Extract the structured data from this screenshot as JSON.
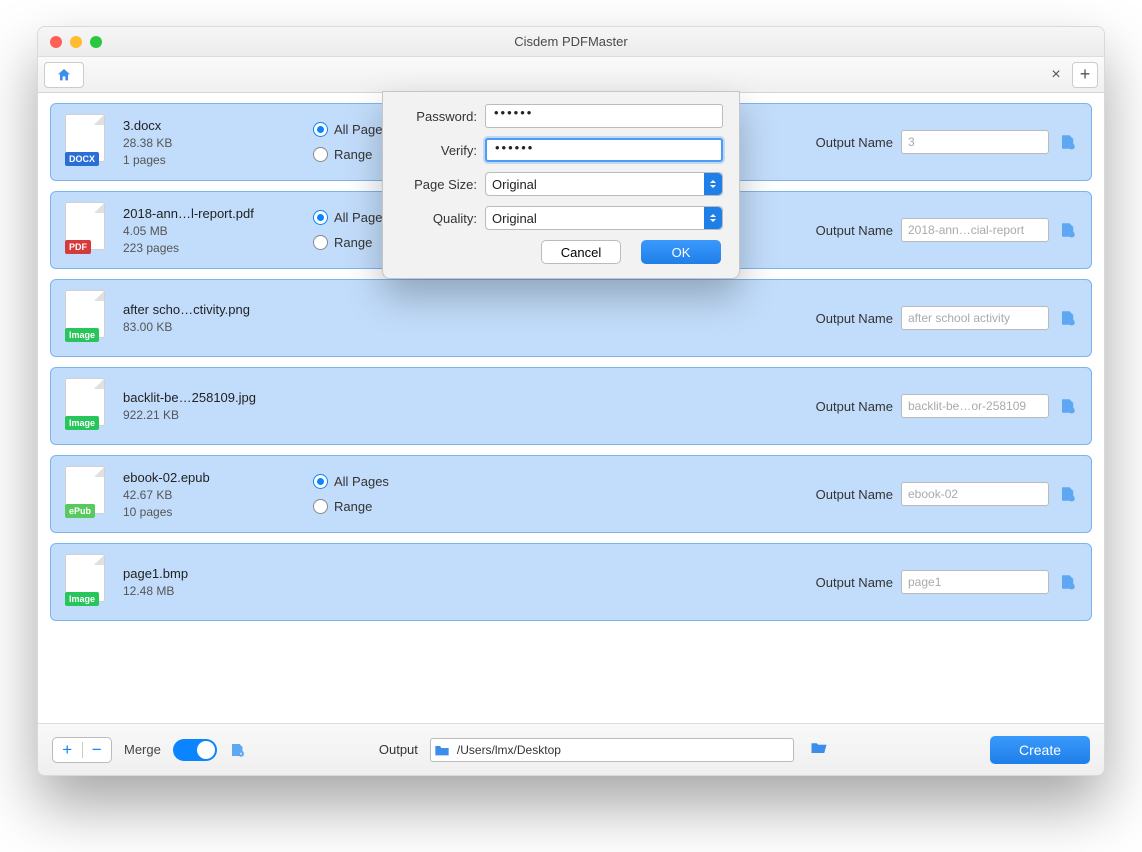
{
  "app": {
    "title": "Cisdem PDFMaster"
  },
  "toolbar": {
    "close": "×",
    "add": "+"
  },
  "files": [
    {
      "icon": "docx",
      "badge": "DOCX",
      "name": "3.docx",
      "size": "28.38 KB",
      "pages": "1 pages",
      "hasPages": true,
      "allPages": "All Pages",
      "range": "Range",
      "outLabel": "Output Name",
      "outValue": "3"
    },
    {
      "icon": "pdf",
      "badge": "PDF",
      "name": "2018-ann…l-report.pdf",
      "size": "4.05 MB",
      "pages": "223 pages",
      "hasPages": true,
      "allPages": "All Pages",
      "range": "Range",
      "outLabel": "Output Name",
      "outValue": "2018-ann…cial-report"
    },
    {
      "icon": "img",
      "badge": "Image",
      "name": "after scho…ctivity.png",
      "size": "83.00 KB",
      "pages": "",
      "hasPages": false,
      "outLabel": "Output Name",
      "outValue": "after school activity"
    },
    {
      "icon": "img",
      "badge": "Image",
      "name": "backlit-be…258109.jpg",
      "size": "922.21 KB",
      "pages": "",
      "hasPages": false,
      "outLabel": "Output Name",
      "outValue": "backlit-be…or-258109"
    },
    {
      "icon": "epub",
      "badge": "ePub",
      "name": "ebook-02.epub",
      "size": "42.67 KB",
      "pages": "10 pages",
      "hasPages": true,
      "allPages": "All Pages",
      "range": "Range",
      "outLabel": "Output Name",
      "outValue": "ebook-02"
    },
    {
      "icon": "img",
      "badge": "Image",
      "name": "page1.bmp",
      "size": "12.48 MB",
      "pages": "",
      "hasPages": false,
      "outLabel": "Output Name",
      "outValue": "page1"
    }
  ],
  "bottom": {
    "merge": "Merge",
    "outputLabel": "Output",
    "outputPath": "/Users/lmx/Desktop",
    "create": "Create"
  },
  "dialog": {
    "passwordLabel": "Password:",
    "passwordValue": "••••••",
    "verifyLabel": "Verify:",
    "verifyValue": "••••••",
    "pageSizeLabel": "Page Size:",
    "pageSizeValue": "Original",
    "qualityLabel": "Quality:",
    "qualityValue": "Original",
    "cancel": "Cancel",
    "ok": "OK"
  }
}
